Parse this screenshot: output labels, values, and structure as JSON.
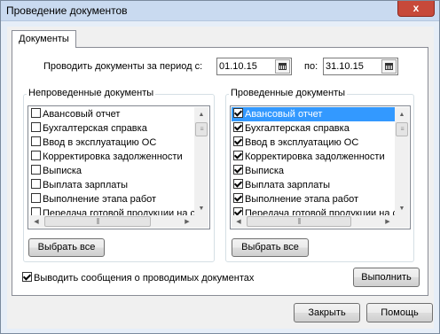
{
  "window": {
    "title": "Проведение документов",
    "close_label": "x"
  },
  "tabs": [
    {
      "label": "Документы"
    }
  ],
  "period": {
    "label": "Проводить документы за период с:",
    "from": "01.10.15",
    "to_label": "по:",
    "to": "31.10.15"
  },
  "unposted": {
    "title": "Непроведенные документы",
    "items": [
      {
        "label": "Авансовый отчет",
        "checked": false
      },
      {
        "label": "Бухгалтерская справка",
        "checked": false
      },
      {
        "label": "Ввод в эксплуатацию ОС",
        "checked": false
      },
      {
        "label": "Корректировка задолженности",
        "checked": false
      },
      {
        "label": "Выписка",
        "checked": false
      },
      {
        "label": "Выплата зарплаты",
        "checked": false
      },
      {
        "label": "Выполнение этапа работ",
        "checked": false
      },
      {
        "label": "Передача готовой продукции на с",
        "checked": false
      }
    ],
    "select_all": "Выбрать все"
  },
  "posted": {
    "title": "Проведенные документы",
    "items": [
      {
        "label": "Авансовый отчет",
        "checked": true,
        "selected": true
      },
      {
        "label": "Бухгалтерская справка",
        "checked": true
      },
      {
        "label": "Ввод в эксплуатацию ОС",
        "checked": true
      },
      {
        "label": "Корректировка задолженности",
        "checked": true
      },
      {
        "label": "Выписка",
        "checked": true
      },
      {
        "label": "Выплата зарплаты",
        "checked": true
      },
      {
        "label": "Выполнение этапа работ",
        "checked": true
      },
      {
        "label": "Передача готовой продукции на с",
        "checked": true
      }
    ],
    "select_all": "Выбрать все"
  },
  "messages_option": {
    "label": "Выводить сообщения о проводимых документах",
    "checked": true
  },
  "buttons": {
    "run": "Выполнить",
    "close": "Закрыть",
    "help": "Помощь"
  },
  "icons": {
    "close": "close-icon",
    "calendar": "calendar-icon",
    "checkbox": "checkbox-icon",
    "scroll_up": "scroll-up-arrow-icon",
    "scroll_down": "scroll-down-arrow-icon",
    "scroll_left": "scroll-left-arrow-icon",
    "scroll_right": "scroll-right-arrow-icon"
  },
  "colors": {
    "selection": "#3399ff",
    "title_bar": "#c9daf0",
    "close_button": "#c7493a"
  }
}
